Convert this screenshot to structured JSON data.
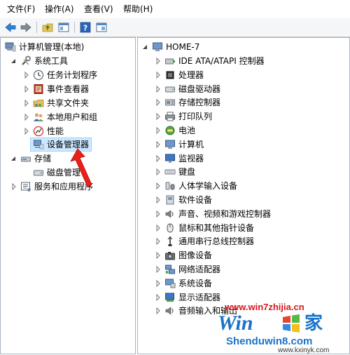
{
  "menu": {
    "file": "文件(F)",
    "action": "操作(A)",
    "view": "查看(V)",
    "help": "帮助(H)"
  },
  "left_tree": {
    "root": "计算机管理(本地)",
    "system_tools": "系统工具",
    "task_scheduler": "任务计划程序",
    "event_viewer": "事件查看器",
    "shared_folders": "共享文件夹",
    "local_users": "本地用户和组",
    "performance": "性能",
    "device_manager": "设备管理器",
    "storage": "存储",
    "disk_management": "磁盘管理",
    "services_apps": "服务和应用程序"
  },
  "right_tree": {
    "root": "HOME-7",
    "items": [
      {
        "label": "IDE ATA/ATAPI 控制器",
        "icon": "ide-controller-icon"
      },
      {
        "label": "处理器",
        "icon": "processor-icon"
      },
      {
        "label": "磁盘驱动器",
        "icon": "disk-drive-icon"
      },
      {
        "label": "存储控制器",
        "icon": "storage-controller-icon"
      },
      {
        "label": "打印队列",
        "icon": "printer-icon"
      },
      {
        "label": "电池",
        "icon": "battery-icon"
      },
      {
        "label": "计算机",
        "icon": "computer-icon"
      },
      {
        "label": "监视器",
        "icon": "monitor-icon"
      },
      {
        "label": "键盘",
        "icon": "keyboard-icon"
      },
      {
        "label": "人体学输入设备",
        "icon": "hid-icon"
      },
      {
        "label": "软件设备",
        "icon": "software-device-icon"
      },
      {
        "label": "声音、视频和游戏控制器",
        "icon": "sound-icon"
      },
      {
        "label": "鼠标和其他指针设备",
        "icon": "mouse-icon"
      },
      {
        "label": "通用串行总线控制器",
        "icon": "usb-icon"
      },
      {
        "label": "图像设备",
        "icon": "camera-icon"
      },
      {
        "label": "网络适配器",
        "icon": "network-adapter-icon"
      },
      {
        "label": "系统设备",
        "icon": "system-device-icon"
      },
      {
        "label": "显示适配器",
        "icon": "display-adapter-icon"
      },
      {
        "label": "音频输入和输出",
        "icon": "audio-io-icon"
      }
    ]
  },
  "watermark": {
    "line1": "www.win7zhijia.cn",
    "logo_prefix": "Win",
    "logo_suffix": "家",
    "line2": "Shenduwin8.com",
    "line3": "www.kxinyk.com"
  },
  "colors": {
    "selection": "#cce8ff",
    "pane_border": "#a9b3bf",
    "arrow_red": "#e8201a",
    "watermark_red": "#d9141b",
    "watermark_blue": "#1a73c8"
  }
}
